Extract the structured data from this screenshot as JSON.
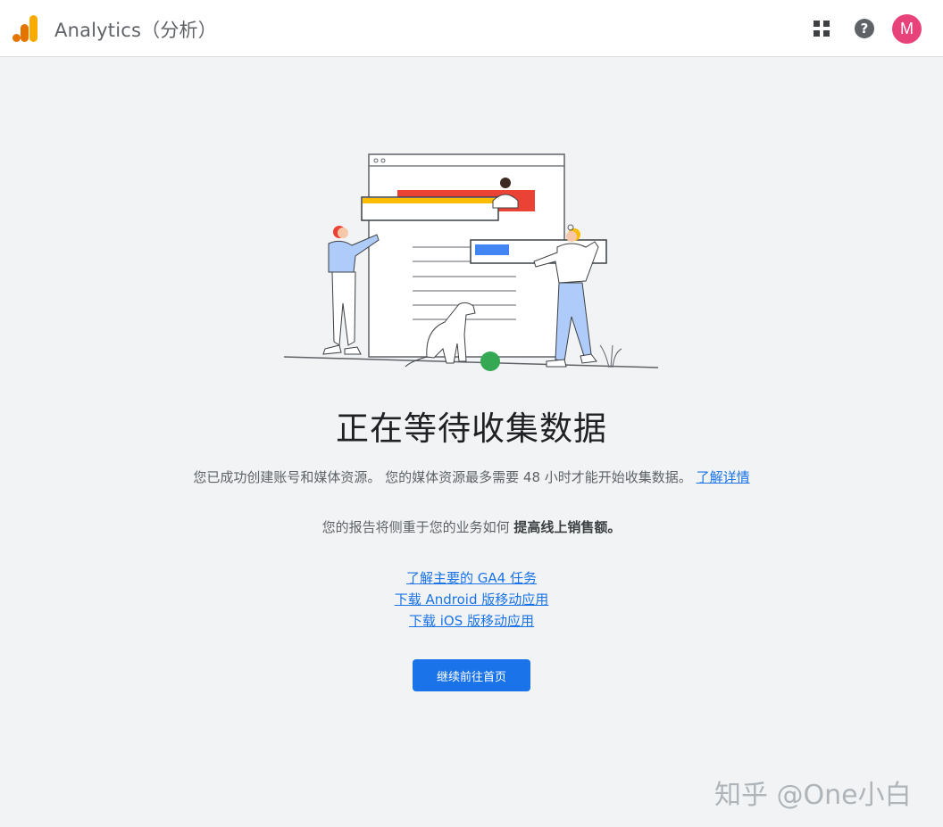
{
  "header": {
    "app_title": "Analytics（分析）",
    "logo_icon": "analytics-bars-icon",
    "apps_icon": "apps-grid-icon",
    "help_icon": "help-icon",
    "help_glyph": "?",
    "avatar_initial": "M"
  },
  "main": {
    "headline": "正在等待收集数据",
    "subline_text": "您已成功创建账号和媒体资源。 您的媒体资源最多需要 48 小时才能开始收集数据。",
    "subline_link": "了解详情",
    "focus_text": "您的报告将侧重于您的业务如何",
    "focus_bold": "提高线上销售额。",
    "links": [
      {
        "label": "了解主要的 GA4 任务"
      },
      {
        "label": "下载 Android 版移动应用"
      },
      {
        "label": "下载 iOS 版移动应用"
      }
    ],
    "continue_button": "继续前往首页"
  },
  "watermark": "知乎 @One小白",
  "colors": {
    "accent_blue": "#1a73e8",
    "avatar_pink": "#e8427a",
    "logo_orange": "#f9ab00",
    "logo_dark_orange": "#e37400",
    "background": "#f1f3f4"
  }
}
